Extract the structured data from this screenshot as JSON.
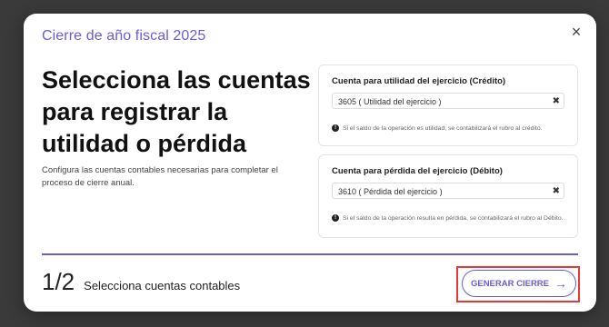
{
  "modal": {
    "title": "Cierre de año fiscal 2025",
    "close_icon": "×",
    "headline": "Selecciona las cuentas para registrar la utilidad o pérdida",
    "description": "Configura las cuentas contables necesarias para completar el proceso de cierre anual."
  },
  "cards": [
    {
      "label": "Cuenta para utilidad del ejercicio (Crédito)",
      "value": "3605 ( Utilidad del ejercicio )",
      "clear": "✖",
      "info_icon": "!",
      "info": "Si el saldo de la operación es utilidad, se contabilizará el rubro al crédito."
    },
    {
      "label": "Cuenta para pérdida del ejercicio (Débito)",
      "value": "3610 ( Pérdida del ejercicio )",
      "clear": "✖",
      "info_icon": "!",
      "info": "Si el saldo de la operación resulta en pérdida, se contabilizará el rubro al Débito."
    }
  ],
  "footer": {
    "step": "1/2",
    "step_label": "Selecciona cuentas contables",
    "button_label": "GENERAR CIERRE",
    "button_arrow": "→"
  },
  "colors": {
    "accent": "#6b5cd6",
    "highlight": "#e53935"
  }
}
